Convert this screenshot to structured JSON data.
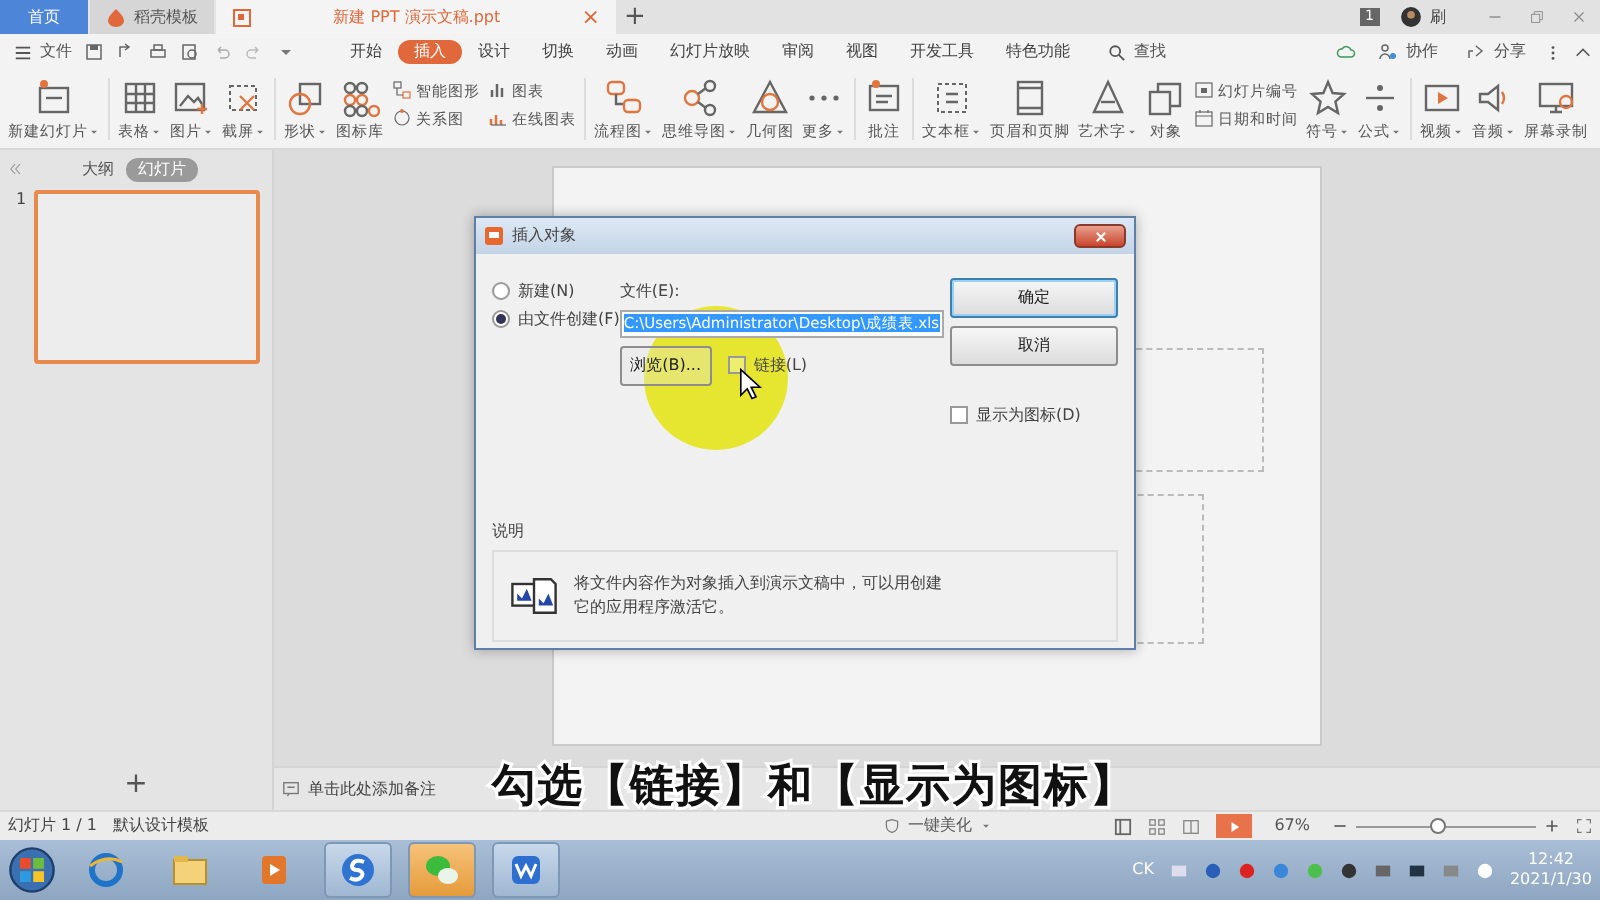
{
  "tabs": [
    {
      "label": "首页",
      "selected": false,
      "kind": "home"
    },
    {
      "label": "稻壳模板",
      "selected": false,
      "kind": "doc"
    },
    {
      "label": "新建 PPT 演示文稿.ppt",
      "selected": true,
      "kind": "doc"
    }
  ],
  "tab_close": "×",
  "tab_add": "+",
  "account": {
    "badge": "1",
    "name": "刷"
  },
  "menu": {
    "file": "文件",
    "tabs": [
      {
        "label": "开始",
        "selected": false
      },
      {
        "label": "插入",
        "selected": true
      },
      {
        "label": "设计",
        "selected": false
      },
      {
        "label": "切换",
        "selected": false
      },
      {
        "label": "动画",
        "selected": false
      },
      {
        "label": "幻灯片放映",
        "selected": false
      },
      {
        "label": "审阅",
        "selected": false
      },
      {
        "label": "视图",
        "selected": false
      },
      {
        "label": "开发工具",
        "selected": false
      },
      {
        "label": "特色功能",
        "selected": false
      }
    ],
    "search": "查找",
    "collab": "协作",
    "share": "分享"
  },
  "ribbon": [
    {
      "items": [
        {
          "kind": "large",
          "label": "新建幻灯片",
          "dropdown": true
        }
      ]
    },
    {
      "items": [
        {
          "kind": "large",
          "label": "表格",
          "dropdown": true
        },
        {
          "kind": "large",
          "label": "图片",
          "dropdown": true
        },
        {
          "kind": "large",
          "label": "截屏",
          "dropdown": true
        }
      ]
    },
    {
      "items": [
        {
          "kind": "large",
          "label": "形状",
          "dropdown": true
        },
        {
          "kind": "large",
          "label": "图标库",
          "dropdown": false
        },
        {
          "kind": "stack",
          "items": [
            {
              "label": "智能图形"
            },
            {
              "label": "关系图"
            }
          ]
        },
        {
          "kind": "stack",
          "items": [
            {
              "label": "图表"
            },
            {
              "label": "在线图表"
            }
          ]
        }
      ]
    },
    {
      "items": [
        {
          "kind": "large",
          "label": "流程图",
          "dropdown": true
        },
        {
          "kind": "large",
          "label": "思维导图",
          "dropdown": true
        },
        {
          "kind": "large",
          "label": "几何图",
          "dropdown": false
        },
        {
          "kind": "large",
          "label": "更多",
          "dropdown": true
        }
      ]
    },
    {
      "items": [
        {
          "kind": "large",
          "label": "批注",
          "dropdown": false
        }
      ]
    },
    {
      "items": [
        {
          "kind": "large",
          "label": "文本框",
          "dropdown": true
        },
        {
          "kind": "large",
          "label": "页眉和页脚",
          "dropdown": false
        },
        {
          "kind": "large",
          "label": "艺术字",
          "dropdown": true
        },
        {
          "kind": "large",
          "label": "对象",
          "dropdown": false
        },
        {
          "kind": "stack",
          "items": [
            {
              "label": "幻灯片编号"
            },
            {
              "label": "日期和时间"
            }
          ]
        },
        {
          "kind": "large",
          "label": "符号",
          "dropdown": true
        },
        {
          "kind": "large",
          "label": "公式",
          "dropdown": true
        }
      ]
    },
    {
      "items": [
        {
          "kind": "large",
          "label": "视频",
          "dropdown": true
        },
        {
          "kind": "large",
          "label": "音频",
          "dropdown": true
        },
        {
          "kind": "large",
          "label": "屏幕录制",
          "dropdown": false
        }
      ]
    }
  ],
  "panel": {
    "tabs": [
      {
        "label": "大纲",
        "selected": false
      },
      {
        "label": "幻灯片",
        "selected": true
      }
    ],
    "slides": [
      {
        "number": "1",
        "selected": true
      }
    ],
    "add": "+"
  },
  "notes_placeholder": "单击此处添加备注",
  "dialog": {
    "title": "插入对象",
    "options": [
      {
        "label": "新建(N)",
        "selected": false
      },
      {
        "label": "由文件创建(F)",
        "selected": true
      }
    ],
    "file_label": "文件(E):",
    "file_value": "C:\\Users\\Administrator\\Desktop\\成绩表.xls",
    "value_highlighted": true,
    "browse": "浏览(B)...",
    "link": {
      "label": "链接(L)",
      "checked": false
    },
    "show_icon": {
      "label": "显示为图标(D)",
      "checked": false
    },
    "buttons": [
      {
        "label": "确定",
        "default": true
      },
      {
        "label": "取消",
        "default": false
      }
    ],
    "description": {
      "title": "说明",
      "text": "将文件内容作为对象插入到演示文稿中，可以用创建它的应用程序激活它。"
    }
  },
  "caption": "勾选【链接】和【显示为图标】",
  "status": {
    "slide": "幻灯片 1 / 1",
    "template": "默认设计模板",
    "beautify": "一键美化",
    "zoom": "67%",
    "level": 0.45
  },
  "taskbar": {
    "apps": [
      {
        "running": false,
        "attention": false
      },
      {
        "running": false,
        "attention": false
      },
      {
        "running": false,
        "attention": false
      },
      {
        "running": true,
        "attention": false
      },
      {
        "running": true,
        "attention": true
      },
      {
        "running": true,
        "attention": false
      }
    ],
    "input": "CK",
    "time": "12:42",
    "date": "2021/1/30"
  }
}
